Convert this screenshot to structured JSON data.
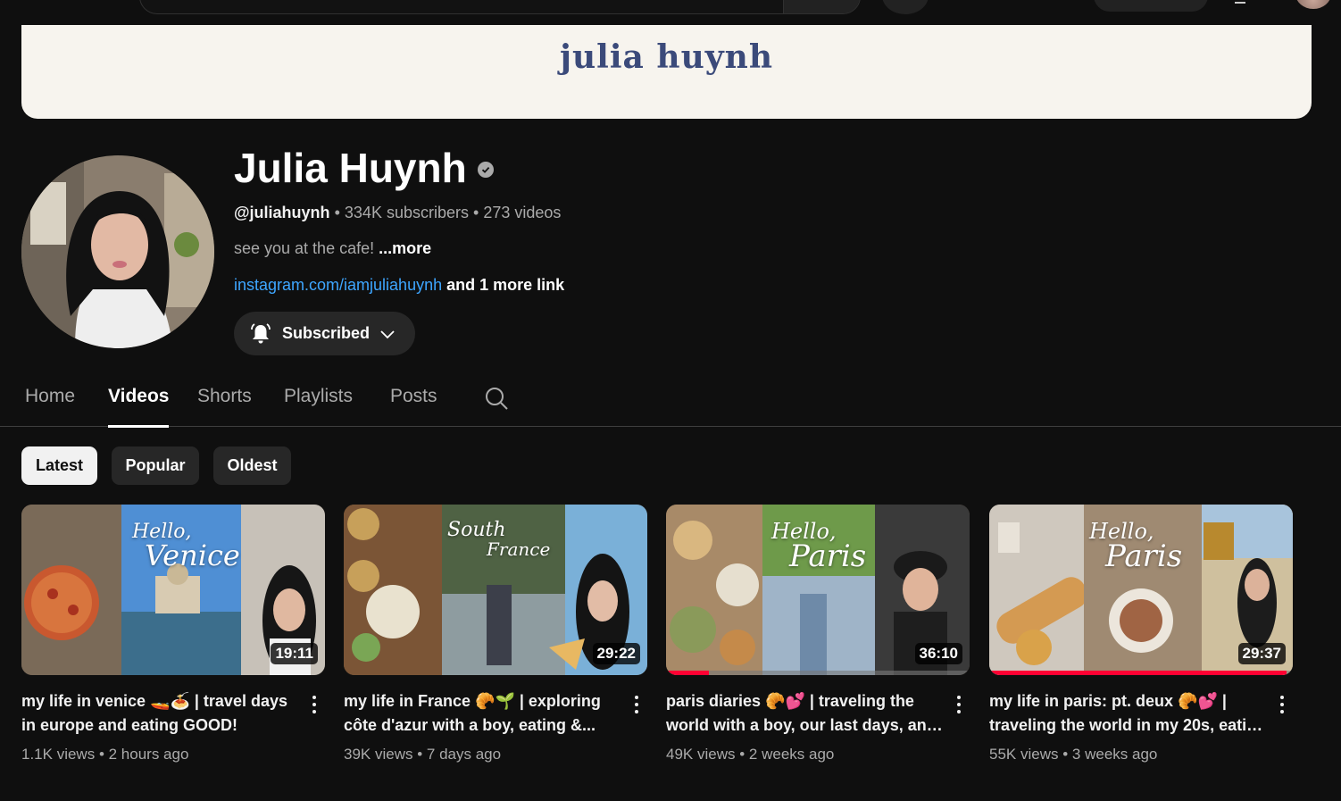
{
  "channel": {
    "banner_text": "julia huynh",
    "name": "Julia Huynh",
    "handle": "@juliahuynh",
    "subscribers": "334K subscribers",
    "videos_count": "273 videos",
    "separator": "•",
    "description": "see you at the cafe!",
    "more_label": "...more",
    "link": "instagram.com/iamjuliahuynh",
    "more_links": "and 1 more link",
    "subscribe_label": "Subscribed"
  },
  "tabs": [
    {
      "label": "Home",
      "active": false
    },
    {
      "label": "Videos",
      "active": true
    },
    {
      "label": "Shorts",
      "active": false
    },
    {
      "label": "Playlists",
      "active": false
    },
    {
      "label": "Posts",
      "active": false
    }
  ],
  "chips": [
    {
      "label": "Latest",
      "active": true
    },
    {
      "label": "Popular",
      "active": false
    },
    {
      "label": "Oldest",
      "active": false
    }
  ],
  "videos": [
    {
      "thumb_text": [
        "Hello,",
        "Venice"
      ],
      "duration": "19:11",
      "title_line1": "my life in venice 🚤🍝 | travel days",
      "title_line2": "in europe and eating GOOD!",
      "views": "1.1K views",
      "age": "2 hours ago",
      "watch_progress": 0
    },
    {
      "thumb_text": [
        "South",
        "France"
      ],
      "duration": "29:22",
      "title_line1": "my life in France 🥐🌱 | exploring",
      "title_line2": "côte d'azur with a boy, eating &...",
      "views": "39K views",
      "age": "7 days ago",
      "watch_progress": 0
    },
    {
      "thumb_text": [
        "Hello,",
        "Paris"
      ],
      "duration": "36:10",
      "title_line1": "paris diaries 🥐💕 | traveling the",
      "title_line2": "world with a boy, our last days, and...",
      "views": "49K views",
      "age": "2 weeks ago",
      "watch_progress": 0.14
    },
    {
      "thumb_text": [
        "Hello,",
        "Paris"
      ],
      "duration": "29:37",
      "title_line1": "my life in paris: pt. deux 🥐💕 |",
      "title_line2": "traveling the world in my 20s, eatin...",
      "views": "55K views",
      "age": "3 weeks ago",
      "watch_progress": 0.98
    }
  ],
  "colors": {
    "background": "#0f0f0f",
    "link": "#3ea6ff",
    "progress": "#ff0033",
    "banner": "#f7f4ee"
  }
}
